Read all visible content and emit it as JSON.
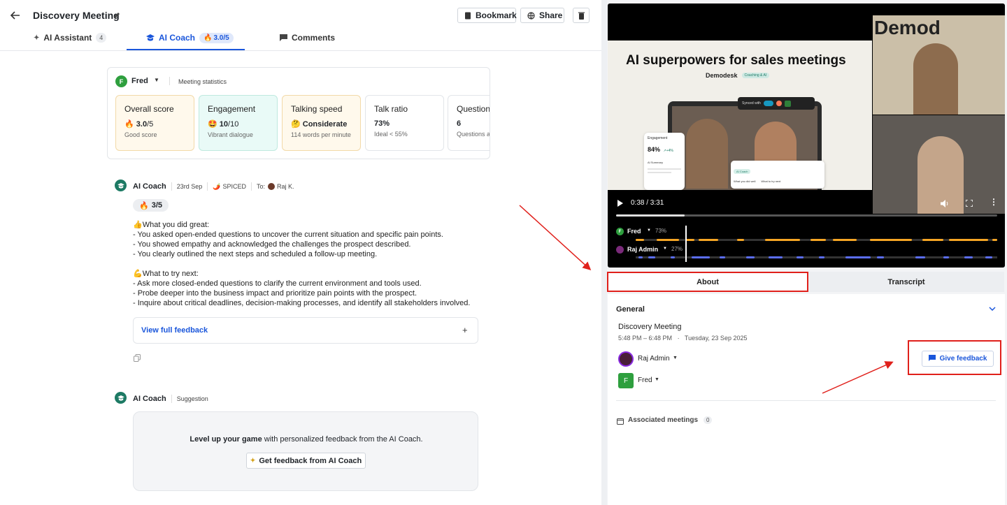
{
  "header": {
    "title": "Discovery Meeting",
    "bookmark_label": "Bookmark",
    "share_label": "Share"
  },
  "tabs": [
    {
      "label": "AI Assistant",
      "count": "4"
    },
    {
      "label": "AI Coach",
      "score": "3.0/5"
    },
    {
      "label": "Comments"
    }
  ],
  "stats": {
    "person": "Fred",
    "person_initial": "F",
    "meeting_statistics_label": "Meeting statistics",
    "cards": [
      {
        "title": "Overall score",
        "emoji": "🔥",
        "value": "3.0",
        "suffix": "/5",
        "sub": "Good score"
      },
      {
        "title": "Engagement",
        "emoji": "🤩",
        "value": "10",
        "suffix": "/10",
        "sub": "Vibrant dialogue"
      },
      {
        "title": "Talking speed",
        "emoji": "🤔",
        "value": "Considerate",
        "suffix": "",
        "sub": "114 words per minute"
      },
      {
        "title": "Talk ratio",
        "emoji": "",
        "value": "73%",
        "suffix": "",
        "sub": "Ideal < 55%"
      },
      {
        "title": "Questions",
        "emoji": "",
        "value": "6",
        "suffix": "",
        "sub": "Questions as"
      }
    ]
  },
  "feedback": {
    "author": "AI Coach",
    "date": "23rd Sep",
    "methodology": "SPICED",
    "to_label": "To:",
    "to_name": "Raj K.",
    "score": "3/5",
    "great_heading": "What you did great:",
    "great_items": [
      "- You asked open-ended questions to uncover the current situation and specific pain points.",
      "- You showed empathy and acknowledged the challenges the prospect described.",
      "- You clearly outlined the next steps and scheduled a follow-up meeting."
    ],
    "try_heading": "What to try next:",
    "try_items": [
      "- Ask more closed-ended questions to clarify the current environment and tools used.",
      "- Probe deeper into the business impact and prioritize pain points with the prospect.",
      "- Inquire about critical deadlines, decision-making processes, and identify all stakeholders involved."
    ],
    "view_full_label": "View full feedback",
    "plus": "+"
  },
  "suggestion": {
    "author": "AI Coach",
    "tag": "Suggestion",
    "headline_bold": "Level up your game",
    "headline_rest": " with personalized feedback from the AI Coach.",
    "button_label": "Get feedback from AI Coach"
  },
  "video": {
    "slide_title": "AI superpowers for sales meetings",
    "brand": "Demodesk",
    "brand_badge": "Coaching & AI",
    "synced_label": "Synced with",
    "engagement_label": "Engagement",
    "engagement_value": "84%",
    "engagement_delta": "+4%",
    "ai_summary_label": "AI Summary",
    "ai_coach_label": "AI Coach",
    "did_well_label": "What you did well",
    "try_next_label": "What to try next",
    "logo_text": "Demod",
    "time": "0:38 / 3:31",
    "progress": 0.18,
    "speakers": [
      {
        "name": "Fred",
        "initial": "F",
        "pct": "73%",
        "color": "#f5a524"
      },
      {
        "name": "Raj Admin",
        "initial": "R",
        "pct": "27%",
        "color": "#5b6ef5"
      }
    ]
  },
  "panel": {
    "tab_about": "About",
    "tab_transcript": "Transcript",
    "general_label": "General",
    "meeting_title": "Discovery Meeting",
    "time_range": "5:48 PM – 6:48 PM",
    "date": "Tuesday, 23 Sep 2025",
    "participants": [
      {
        "name": "Raj Admin"
      },
      {
        "name": "Fred",
        "initial": "F"
      }
    ],
    "give_feedback_label": "Give feedback",
    "associated_label": "Associated meetings",
    "associated_count": "0"
  },
  "colors": {
    "accent": "#1a56db",
    "annotation": "#e0201b",
    "coach": "#1d7a64"
  }
}
